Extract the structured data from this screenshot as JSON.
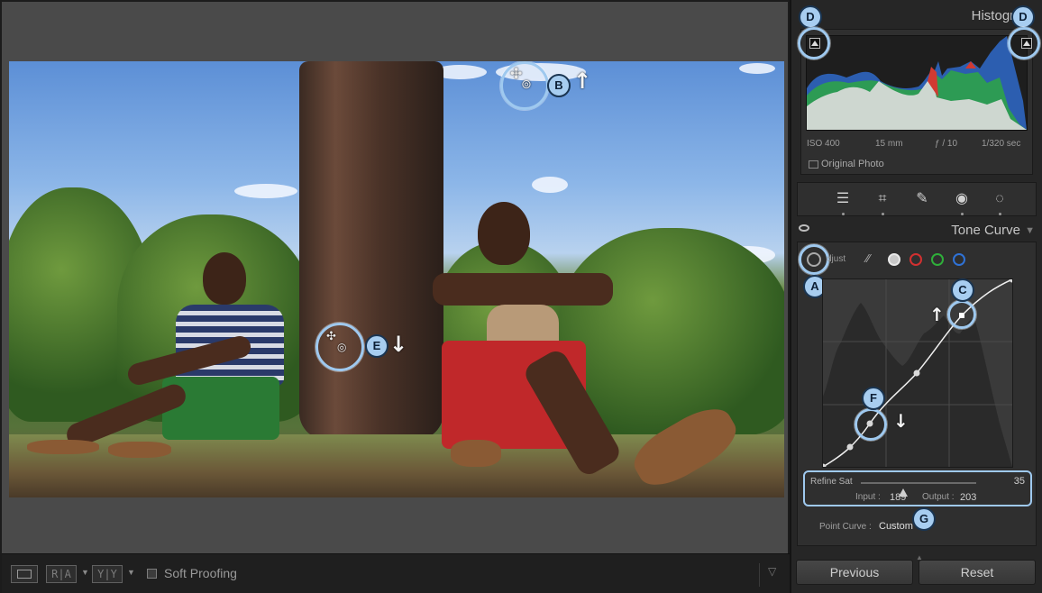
{
  "photo": {
    "alt_subject": "two men sitting by a tree trunk"
  },
  "annotations": {
    "a": "A",
    "b": "B",
    "c": "C",
    "d_left": "D",
    "d_right": "D",
    "e": "E",
    "f": "F",
    "g": "G"
  },
  "histogram": {
    "title": "Histogram",
    "iso": "ISO 400",
    "focal": "15 mm",
    "aperture": "ƒ / 10",
    "shutter": "1/320 sec",
    "original_photo_label": "Original Photo"
  },
  "tools": [
    "sliders-icon",
    "crop-icon",
    "eraser-icon",
    "redeye-icon",
    "radial-mask-icon"
  ],
  "tone_curve": {
    "title": "Tone Curve",
    "adjust_label": "djust",
    "channels": [
      {
        "name": "parametric",
        "color": "#bdbdbd"
      },
      {
        "name": "point",
        "color": "#e8e8e8"
      },
      {
        "name": "red",
        "color": "#d23030"
      },
      {
        "name": "green",
        "color": "#2fae3a"
      },
      {
        "name": "blue",
        "color": "#2f72d6"
      }
    ],
    "refine_sat_label": "Refine Sat",
    "refine_sat_value": "35",
    "refine_sat_level": 0.37,
    "input_label": "Input :",
    "input_value": "189",
    "output_label": "Output :",
    "output_value": "203",
    "point_curve_label": "Point Curve :",
    "point_curve_value": "Custom"
  },
  "toolbar": {
    "view_loupe": "",
    "view_ra": "R|A",
    "view_yy": "Y|Y",
    "soft_proofing_label": "Soft Proofing"
  },
  "buttons": {
    "previous": "Previous",
    "reset": "Reset"
  },
  "colors": {
    "accent": "#9fc9ef",
    "badge": "#a7cdf0"
  }
}
